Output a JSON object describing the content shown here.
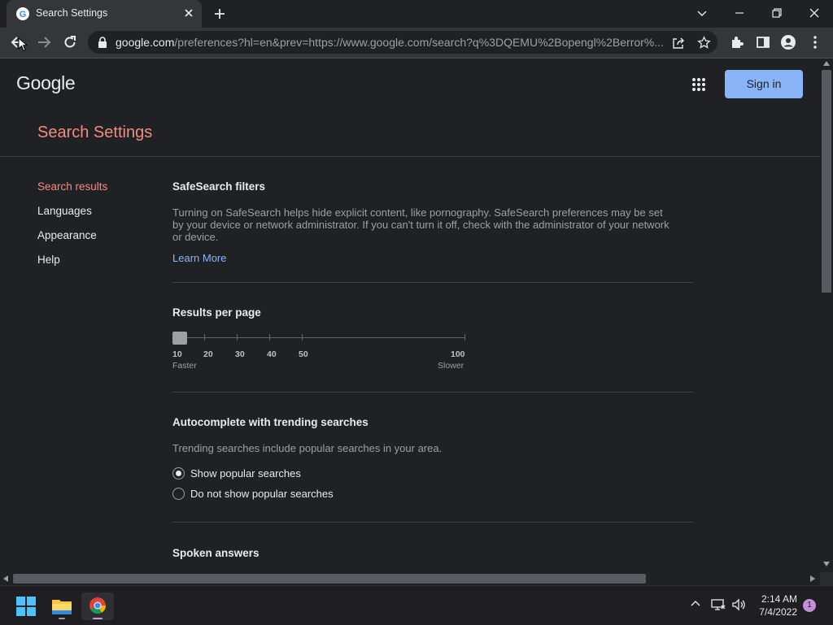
{
  "browser": {
    "tab": {
      "title": "Search Settings"
    },
    "address": {
      "host": "google.com",
      "path": "/preferences?hl=en&prev=https://www.google.com/search?q%3DQEMU%2Bopengl%2Berror%..."
    }
  },
  "page": {
    "logo": "Google",
    "signin_label": "Sign in",
    "title": "Search Settings",
    "nav": [
      "Search results",
      "Languages",
      "Appearance",
      "Help"
    ],
    "safesearch": {
      "heading": "SafeSearch filters",
      "description_lines": [
        "Turning on SafeSearch helps hide explicit content, like pornography. SafeSearch preferences may be set",
        "by your device or network administrator. If you can't turn it off, check with the administrator of your network",
        "or device."
      ],
      "learn_more": "Learn More"
    },
    "results_per_page": {
      "heading": "Results per page",
      "value": 10,
      "labels": [
        "10",
        "20",
        "30",
        "40",
        "50",
        "100"
      ],
      "left_sub": "Faster",
      "right_sub": "Slower"
    },
    "autocomplete": {
      "heading": "Autocomplete with trending searches",
      "description": "Trending searches include popular searches in your area.",
      "options": [
        "Show popular searches",
        "Do not show popular searches"
      ],
      "selected": 0
    },
    "spoken": {
      "heading": "Spoken answers"
    }
  },
  "taskbar": {
    "time": "2:14 AM",
    "date": "7/4/2022",
    "notification_count": "1"
  },
  "colors": {
    "accent_red": "#f28b82",
    "link_blue": "#8ab4f8",
    "background": "#202124"
  }
}
